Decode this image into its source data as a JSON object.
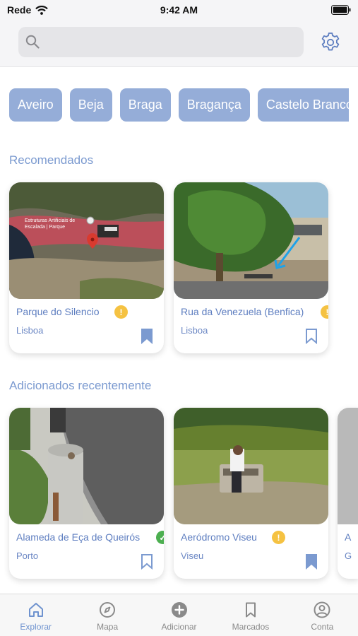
{
  "status_bar": {
    "carrier": "Rede",
    "time": "9:42 AM"
  },
  "search": {
    "placeholder": "",
    "value": ""
  },
  "cities": [
    "Aveiro",
    "Beja",
    "Braga",
    "Bragança",
    "Castelo Branco"
  ],
  "sections": {
    "recommended": "Recomendados",
    "recent": "Adicionados recentemente"
  },
  "recommended_cards": [
    {
      "title": "Parque do Silencio",
      "city": "Lisboa",
      "badge": "!",
      "bookmarked": true,
      "map_label": "Estruturas Artificiais de Escalada | Parque"
    },
    {
      "title": "Rua da Venezuela (Benfica)",
      "city": "Lisboa",
      "badge": "!",
      "bookmarked": false
    }
  ],
  "recent_cards": [
    {
      "title": "Alameda de Eça de Queirós",
      "city": "Porto",
      "badge": "✓",
      "bookmarked": false
    },
    {
      "title": "Aeródromo Viseu",
      "city": "Viseu",
      "badge": "!",
      "bookmarked": true
    },
    {
      "title": "A",
      "city": "G"
    }
  ],
  "tabs": [
    {
      "label": "Explorar",
      "icon": "home-icon",
      "active": true
    },
    {
      "label": "Mapa",
      "icon": "compass-icon",
      "active": false
    },
    {
      "label": "Adicionar",
      "icon": "add-circle-icon",
      "active": false
    },
    {
      "label": "Marcados",
      "icon": "bookmark-icon",
      "active": false
    },
    {
      "label": "Conta",
      "icon": "account-icon",
      "active": false
    }
  ],
  "colors": {
    "accent": "#95add8",
    "title_text": "#5e7ec0",
    "section_title": "#7b9ad0",
    "warn_badge": "#f5c242",
    "ok_badge": "#4caf50"
  }
}
